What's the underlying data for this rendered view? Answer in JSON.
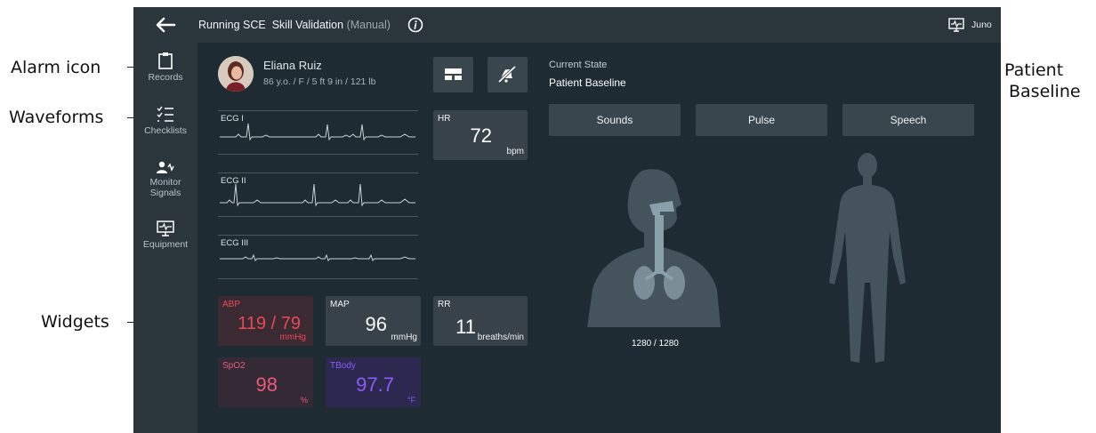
{
  "annotations": {
    "alarm_icon": "Alarm icon",
    "waveforms": "Waveforms",
    "widgets": "Widgets",
    "patient_baseline_line1": "Patient",
    "patient_baseline_line2": "Baseline"
  },
  "header": {
    "back_icon": "arrow-left-icon",
    "title": "Running SCE",
    "scenario": "Skill Validation",
    "mode": "(Manual)",
    "info_icon": "info-icon",
    "monitor_icon": "monitor-icon",
    "user": "Juno"
  },
  "sidebar": {
    "items": [
      {
        "label": "Records",
        "icon": "clipboard-icon"
      },
      {
        "label": "Checklists",
        "icon": "checklist-icon"
      },
      {
        "label": "Monitor Signals",
        "icon": "monitor-signals-icon"
      },
      {
        "label": "Equipment",
        "icon": "equipment-icon"
      }
    ]
  },
  "patient": {
    "name": "Eliana Ruiz",
    "details": "86 y.o. / F / 5 ft 9 in / 121 lb"
  },
  "waveforms": [
    {
      "label": "ECG I"
    },
    {
      "label": "ECG II"
    },
    {
      "label": "ECG III"
    }
  ],
  "widgets": {
    "hr": {
      "label": "HR",
      "value": "72",
      "unit": "bpm"
    },
    "abp": {
      "label": "ABP",
      "value": "119 / 79",
      "unit": "mmHg",
      "color": "#e8495a"
    },
    "map": {
      "label": "MAP",
      "value": "96",
      "unit": "mmHg"
    },
    "rr": {
      "label": "RR",
      "value": "11",
      "unit": "breaths/min"
    },
    "spo2": {
      "label": "SpO2",
      "value": "98",
      "unit": "%",
      "color": "#ea5a7a"
    },
    "tbody": {
      "label": "TBody",
      "value": "97.7",
      "unit": "°F",
      "color": "#8b5cf6"
    }
  },
  "state": {
    "label": "Current State",
    "value": "Patient Baseline"
  },
  "tabs": [
    "Sounds",
    "Pulse",
    "Speech"
  ],
  "airway": {
    "reading": "1280 / 1280"
  },
  "colors": {
    "screen_bg": "#1f2b32",
    "panel": "#2a353c",
    "widget": "#37424a"
  }
}
